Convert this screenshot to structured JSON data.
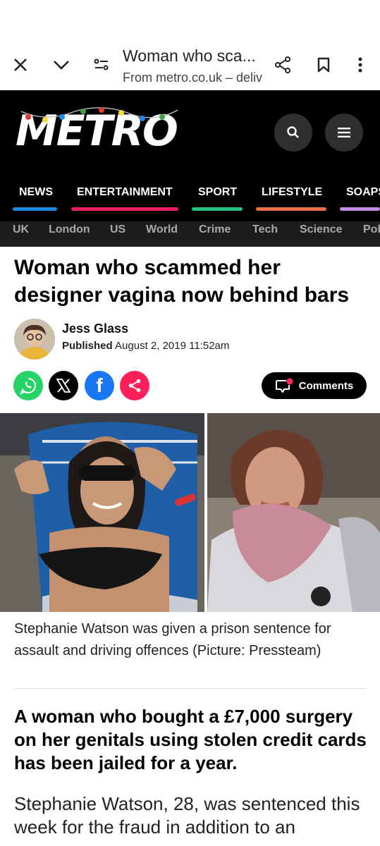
{
  "browser": {
    "title": "Woman who sca...",
    "subtitle": "From metro.co.uk – deliv",
    "icons": [
      "close-icon",
      "chevron-down-icon",
      "page-settings-icon",
      "share-icon",
      "bookmark-icon",
      "more-vert-icon"
    ]
  },
  "site": {
    "logo": "METRO",
    "icons": [
      "search-icon",
      "menu-icon"
    ],
    "main_nav": [
      "NEWS",
      "ENTERTAINMENT",
      "SPORT",
      "LIFESTYLE",
      "SOAPS"
    ],
    "main_nav_colors": [
      "#1e88e5",
      "#e91e63",
      "#26c281",
      "#ef6c4a",
      "#c58be6"
    ],
    "sub_nav": [
      "UK",
      "London",
      "US",
      "World",
      "Crime",
      "Tech",
      "Science",
      "Pol"
    ]
  },
  "article": {
    "headline": "Woman who scammed her designer vagina now behind bars",
    "author": "Jess Glass",
    "published_label": "Published",
    "published_date": "August 2, 2019 11:52am",
    "share_icons": [
      "whatsapp-icon",
      "x-icon",
      "facebook-icon",
      "share-icon"
    ],
    "share_colors": [
      "#25d366",
      "#000000",
      "#1877f2",
      "#ff1f5a"
    ],
    "comments_label": "Comments",
    "caption": "Stephanie Watson was given a prison sentence for assault and driving offences (Picture: Pressteam)",
    "standfirst": "A woman who bought a £7,000 surgery on her genitals using stolen credit cards has been jailed for a year.",
    "body": "Stephanie Watson, 28, was sentenced this week for the fraud in addition to an"
  }
}
